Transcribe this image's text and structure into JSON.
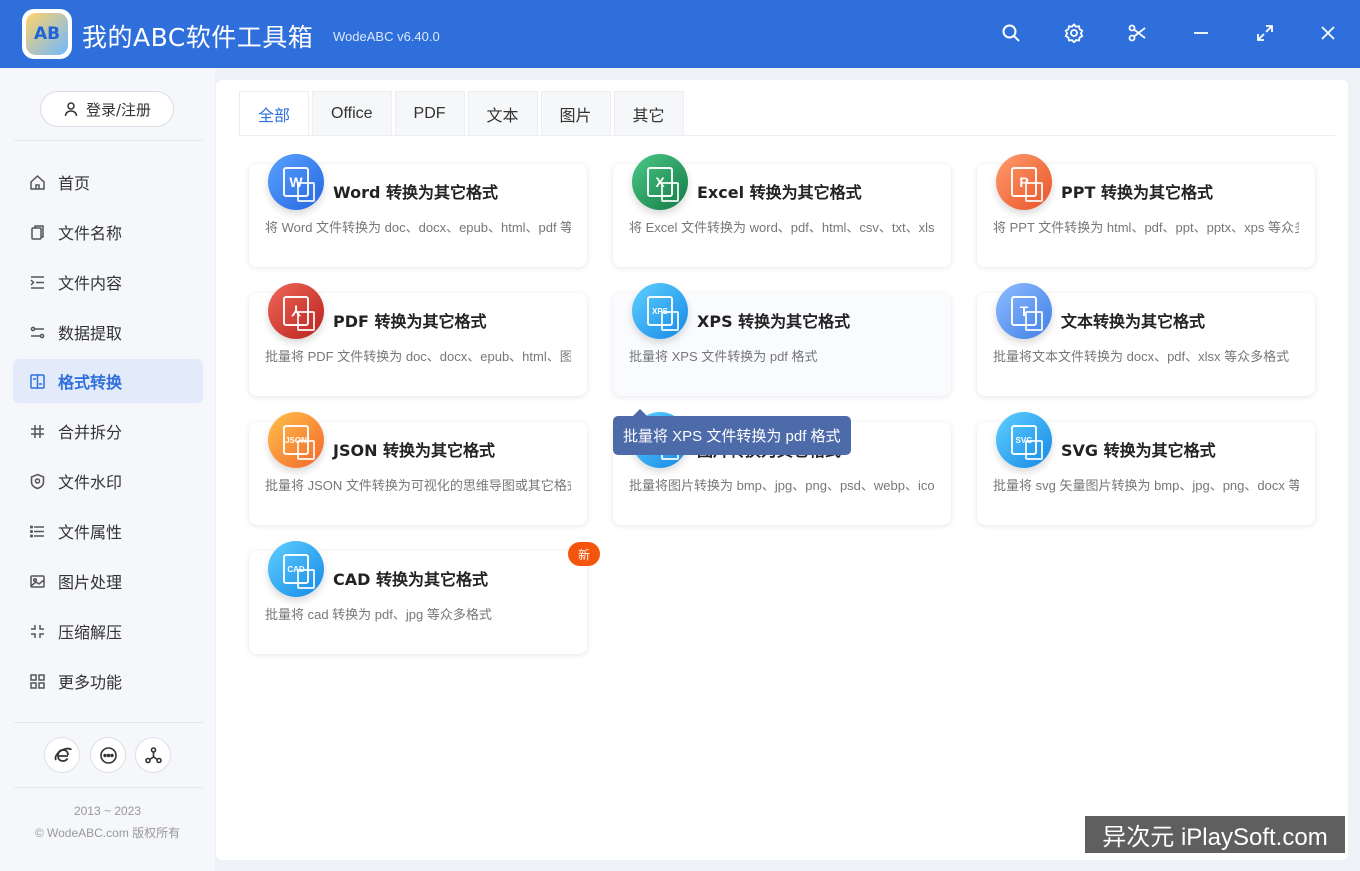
{
  "app": {
    "logo_text": "AB",
    "title": "我的ABC软件工具箱",
    "version": "WodeABC v6.40.0"
  },
  "titlebar_icons": [
    "search-icon",
    "gear-icon",
    "scissors-icon",
    "minimize-icon",
    "maximize-icon",
    "close-icon"
  ],
  "sidebar": {
    "login_label": "登录/注册",
    "items": [
      {
        "label": "首页",
        "icon": "home-icon"
      },
      {
        "label": "文件名称",
        "icon": "file-copy-icon"
      },
      {
        "label": "文件内容",
        "icon": "indent-list-icon"
      },
      {
        "label": "数据提取",
        "icon": "extract-icon"
      },
      {
        "label": "格式转换",
        "icon": "convert-icon",
        "active": true
      },
      {
        "label": "合并拆分",
        "icon": "hash-icon"
      },
      {
        "label": "文件水印",
        "icon": "shield-icon"
      },
      {
        "label": "文件属性",
        "icon": "list-icon"
      },
      {
        "label": "图片处理",
        "icon": "image-icon"
      },
      {
        "label": "压缩解压",
        "icon": "compress-icon"
      },
      {
        "label": "更多功能",
        "icon": "grid-icon"
      }
    ],
    "bottom_buttons": [
      "browser-icon",
      "chat-icon",
      "share-icon"
    ],
    "copyright_years": "2013 ~ 2023",
    "copyright_text": "© WodeABC.com 版权所有"
  },
  "tabs": [
    {
      "label": "全部",
      "active": true
    },
    {
      "label": "Office"
    },
    {
      "label": "PDF"
    },
    {
      "label": "文本"
    },
    {
      "label": "图片"
    },
    {
      "label": "其它"
    }
  ],
  "cards": [
    {
      "title": "Word 转换为其它格式",
      "desc": "将 Word 文件转换为 doc、docx、epub、html、pdf 等众多格式",
      "icon": "word-icon",
      "glyph": "W",
      "color": "#2f7bea"
    },
    {
      "title": "Excel 转换为其它格式",
      "desc": "将 Excel 文件转换为 word、pdf、html、csv、txt、xls 等众多格式",
      "icon": "excel-icon",
      "glyph": "X",
      "color": "#1f9b5a"
    },
    {
      "title": "PPT 转换为其它格式",
      "desc": "将 PPT 文件转换为 html、pdf、ppt、pptx、xps 等众多格式",
      "icon": "ppt-icon",
      "glyph": "P",
      "color": "#f06a3c"
    },
    {
      "title": "PDF 转换为其它格式",
      "desc": "批量将 PDF 文件转换为 doc、docx、epub、html、图片等格式",
      "icon": "pdf-icon",
      "glyph": "⅄",
      "color": "#d8342a"
    },
    {
      "title": "XPS 转换为其它格式",
      "desc": "批量将 XPS 文件转换为 pdf 格式",
      "icon": "xps-icon",
      "glyph": "XPS",
      "color": "#1ea8f0"
    },
    {
      "title": "文本转换为其它格式",
      "desc": "批量将文本文件转换为 docx、pdf、xlsx 等众多格式",
      "icon": "text-icon",
      "glyph": "T",
      "color": "#5e9cf2"
    },
    {
      "title": "JSON 转换为其它格式",
      "desc": "批量将 JSON 文件转换为可视化的思维导图或其它格式",
      "icon": "json-icon",
      "glyph": "JSON",
      "color": "#fb8a3a"
    },
    {
      "title": "图片转换为其它格式",
      "desc": "批量将图片转换为 bmp、jpg、png、psd、webp、ico 等格式",
      "icon": "image-convert-icon",
      "glyph": "IMG",
      "color": "#1ea8f0"
    },
    {
      "title": "SVG 转换为其它格式",
      "desc": "批量将 svg 矢量图片转换为 bmp、jpg、png、docx 等格式",
      "icon": "svg-icon",
      "glyph": "SVG",
      "color": "#1ea8f0"
    },
    {
      "title": "CAD 转换为其它格式",
      "desc": "批量将 cad 转换为 pdf、jpg 等众多格式",
      "icon": "cad-icon",
      "glyph": "CAD",
      "color": "#1ea8f0",
      "badge": "新"
    }
  ],
  "tooltip": "批量将 XPS 文件转换为 pdf 格式",
  "watermark": "异次元 iPlaySoft.com"
}
